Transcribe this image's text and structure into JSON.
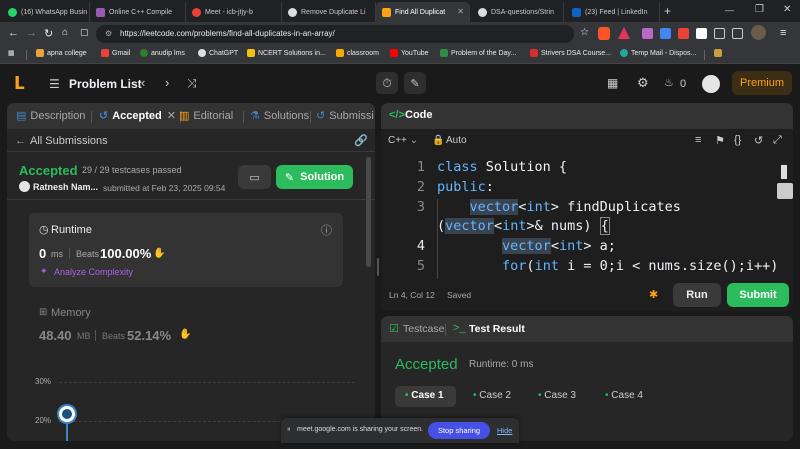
{
  "browser": {
    "tabs": [
      {
        "label": "(16) WhatsApp Busin",
        "color": "#25d366"
      },
      {
        "label": "Online C++ Compile",
        "color": "#9b59b6"
      },
      {
        "label": "Meet - icb-jtjy-b",
        "color": "#ea4335"
      },
      {
        "label": "Remove Duplicate Li",
        "color": "#ffffff"
      },
      {
        "label": "Find All Duplicat",
        "color": "#ffa116"
      },
      {
        "label": "DSA-questions/Strin",
        "color": "#ffffff"
      },
      {
        "label": "(23) Feed | LinkedIn",
        "color": "#0a66c2"
      }
    ],
    "url": "https://leetcode.com/problems/find-all-duplicates-in-an-array/",
    "bookmarks": [
      "apna college",
      "Gmail",
      "anudip lms",
      "ChatGPT",
      "NCERT Solutions in...",
      "classroom",
      "YouTube",
      "Problem of the Day...",
      "Strivers DSA Course...",
      "Temp Mail - Dispos..."
    ]
  },
  "header": {
    "problem_list": "Problem List",
    "streak": "0",
    "premium": "Premium"
  },
  "left": {
    "tabs": {
      "description": "Description",
      "accepted": "Accepted",
      "editorial": "Editorial",
      "solutions": "Solutions",
      "submissions": "Submissi"
    },
    "all_submissions": "All Submissions",
    "status": "Accepted",
    "testcases": "29 / 29 testcases passed",
    "user": "Ratnesh Nam...",
    "submitted": "submitted at Feb 23, 2025 09:54",
    "solution_btn": "Solution",
    "runtime": {
      "title": "Runtime",
      "value": "0",
      "unit": "ms",
      "beats_label": "Beats",
      "beats": "100.00%",
      "analyze": "Analyze Complexity"
    },
    "memory": {
      "title": "Memory",
      "value": "48.40",
      "unit": "MB",
      "beats_label": "Beats",
      "beats": "52.14%"
    },
    "chart_ticks": [
      "30%",
      "20%"
    ]
  },
  "code": {
    "title": "Code",
    "language": "C++",
    "mode": "Auto",
    "line_numbers": [
      "1",
      "2",
      "3",
      "",
      "4",
      "5"
    ],
    "lines": [
      "class Solution {",
      "public:",
      "    vector<int> findDuplicates",
      "(vector<int>& nums) {",
      "    vector<int> a;",
      "    for(int i = 0;i < nums.size();i++)"
    ],
    "cursor": "Ln 4, Col 12",
    "saved": "Saved",
    "run": "Run",
    "submit": "Submit"
  },
  "results": {
    "testcase_tab": "Testcase",
    "result_tab": "Test Result",
    "status": "Accepted",
    "runtime": "Runtime: 0 ms",
    "cases": [
      "Case 1",
      "Case 2",
      "Case 3",
      "Case 4"
    ]
  },
  "share_banner": {
    "text": "meet.google.com is sharing your screen.",
    "stop": "Stop sharing",
    "hide": "Hide"
  }
}
